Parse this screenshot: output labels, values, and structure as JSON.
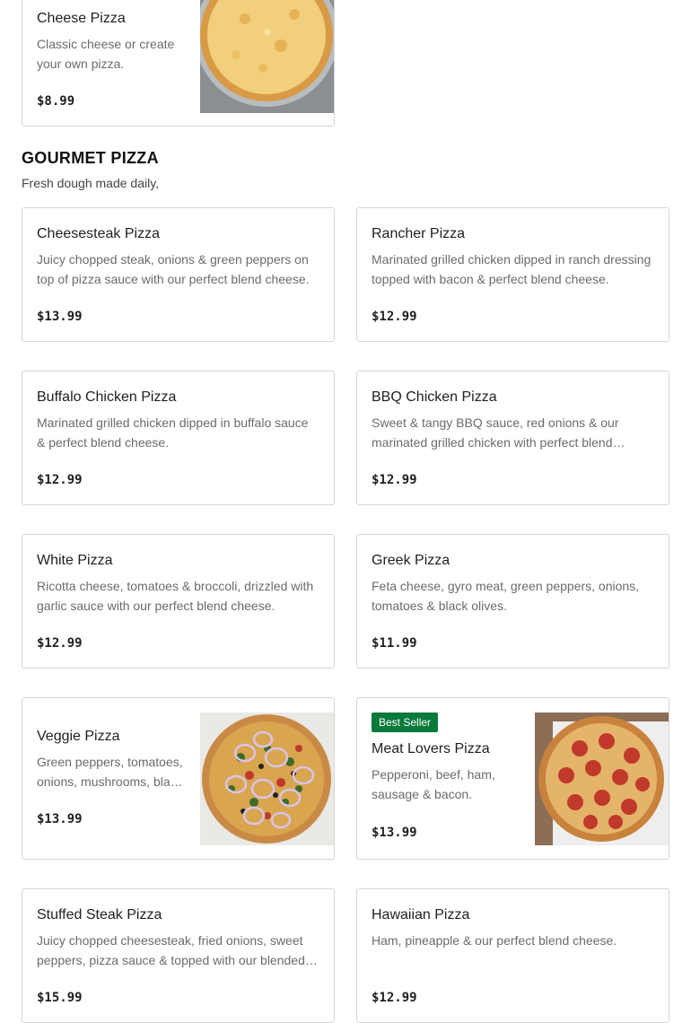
{
  "top_item": {
    "title": "Cheese Pizza",
    "desc": "Classic cheese or create your own pizza.",
    "price": "$8.99"
  },
  "section": {
    "title": "GOURMET PIZZA",
    "subtitle": "Fresh dough made daily,"
  },
  "items": [
    {
      "title": "Cheesesteak Pizza",
      "desc": "Juicy chopped steak, onions & green peppers on top of pizza sauce with our perfect blend cheese.",
      "price": "$13.99"
    },
    {
      "title": "Rancher Pizza",
      "desc": "Marinated grilled chicken dipped in ranch dressing topped with bacon & perfect blend cheese.",
      "price": "$12.99"
    },
    {
      "title": "Buffalo Chicken Pizza",
      "desc": "Marinated grilled chicken dipped in buffalo sauce & perfect blend cheese.",
      "price": "$12.99"
    },
    {
      "title": "BBQ Chicken Pizza",
      "desc": "Sweet & tangy BBQ sauce, red onions & our marinated grilled chicken with perfect blend cheese.",
      "price": "$12.99"
    },
    {
      "title": "White Pizza",
      "desc": "Ricotta cheese, tomatoes & broccoli, drizzled with garlic sauce with our perfect blend cheese.",
      "price": "$12.99"
    },
    {
      "title": "Greek Pizza",
      "desc": "Feta cheese, gyro meat, green peppers, onions, tomatoes & black olives.",
      "price": "$11.99"
    },
    {
      "title": "Veggie Pizza",
      "desc": "Green peppers, tomatoes, onions, mushrooms, black olives & perfect blend cheese.",
      "price": "$13.99"
    },
    {
      "title": "Meat Lovers Pizza",
      "desc": "Pepperoni, beef, ham, sausage & bacon.",
      "price": "$13.99",
      "badge": "Best Seller"
    },
    {
      "title": "Stuffed Steak Pizza",
      "desc": "Juicy chopped cheesesteak, fried onions, sweet peppers, pizza sauce & topped with our blended cheese.",
      "price": "$15.99"
    },
    {
      "title": "Hawaiian Pizza",
      "desc": "Ham, pineapple & our perfect blend cheese.",
      "price": "$12.99"
    }
  ],
  "colors": {
    "badge": "#0a7a3a",
    "border": "#d6d6d6"
  }
}
